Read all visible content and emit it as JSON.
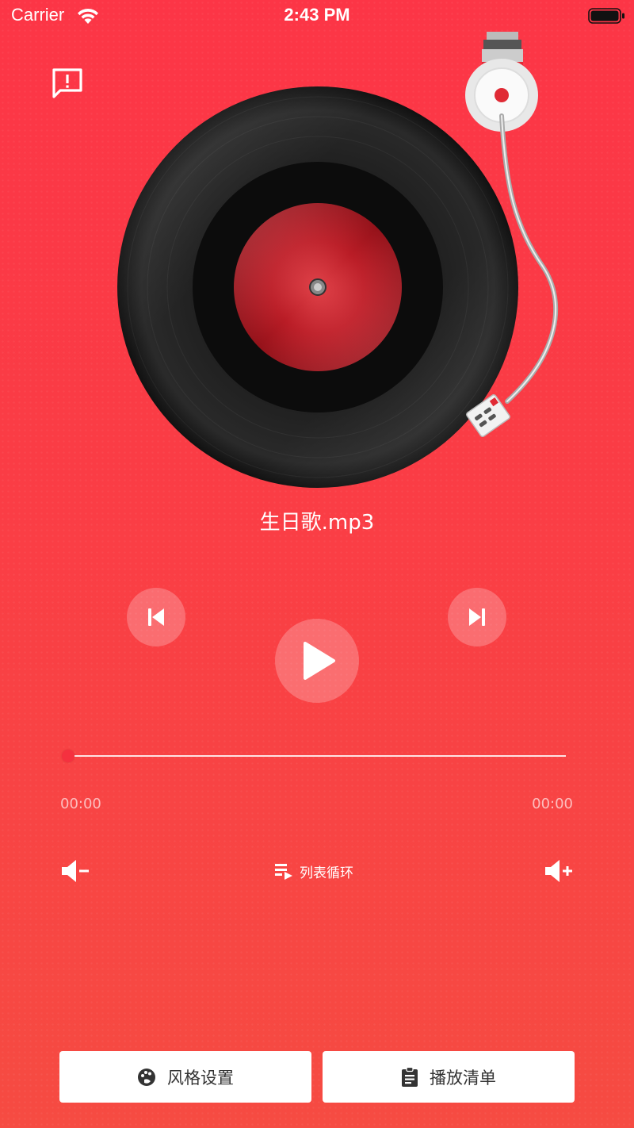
{
  "status_bar": {
    "carrier": "Carrier",
    "time": "2:43 PM"
  },
  "icons": {
    "feedback": "feedback-icon",
    "previous": "skip-previous-icon",
    "play": "play-icon",
    "next": "skip-next-icon",
    "volume_down": "volume-down-icon",
    "volume_up": "volume-up-icon",
    "loop": "playlist-loop-icon",
    "style": "palette-icon",
    "playlist": "clipboard-icon"
  },
  "player": {
    "song_title": "生日歌.mp3",
    "current_time": "00:00",
    "total_time": "00:00",
    "progress": 0,
    "loop_mode": "列表循环"
  },
  "bottom_bar": {
    "style_settings": "风格设置",
    "playlist": "播放清单"
  },
  "colors": {
    "background": "#fc3546",
    "record_label": "#d8222c",
    "thumb": "#f5313f",
    "button_text": "#333333"
  }
}
